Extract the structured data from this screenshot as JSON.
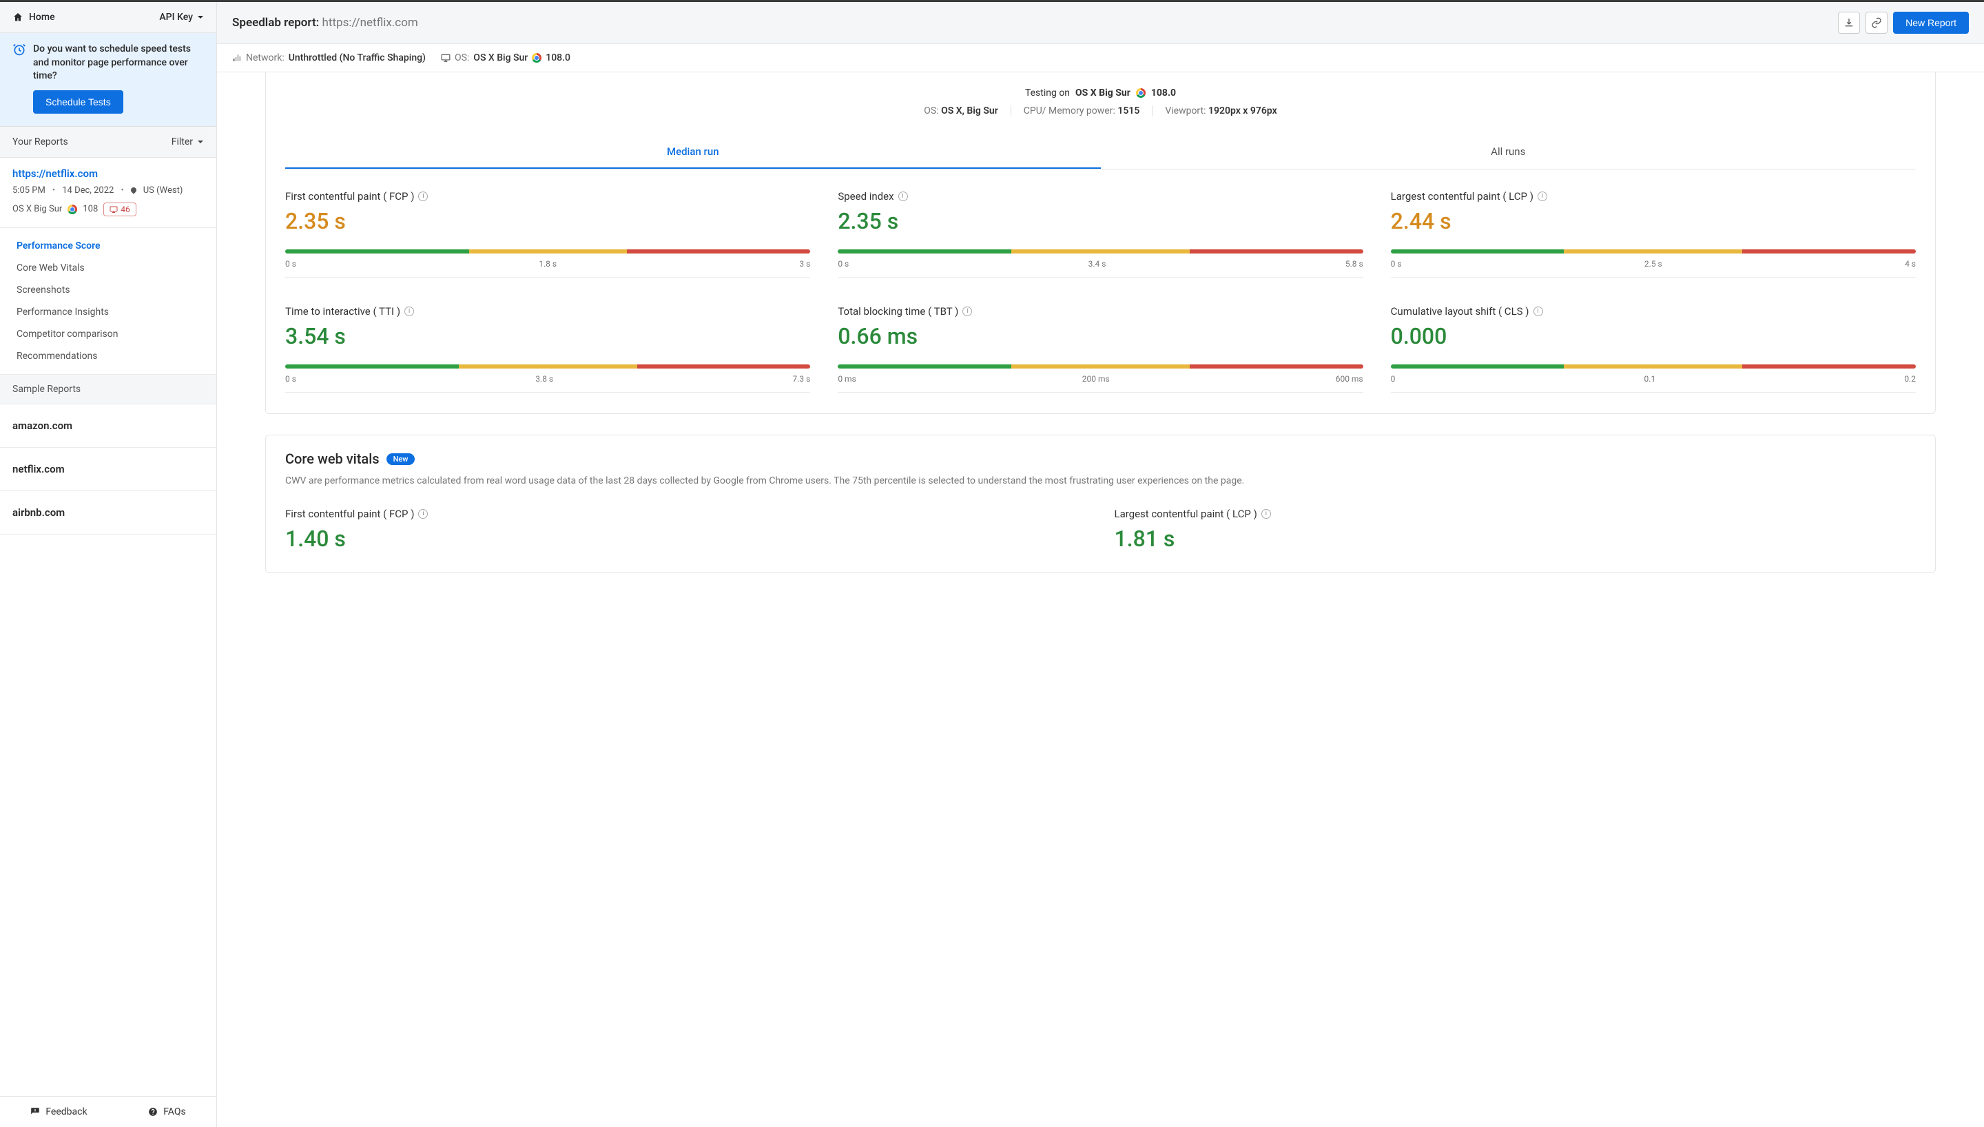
{
  "sidebar": {
    "home": "Home",
    "apikey": "API Key",
    "schedule_prompt": "Do you want to schedule speed tests and monitor page performance over time?",
    "schedule_btn": "Schedule Tests",
    "reports_title": "Your Reports",
    "filter_label": "Filter",
    "current_report": {
      "url": "https://netflix.com",
      "time": "5:05 PM",
      "date": "14 Dec, 2022",
      "location": "US (West)",
      "os": "OS X Big Sur",
      "browser_version": "108",
      "viewport_count": "46"
    },
    "nav": [
      "Performance Score",
      "Core Web Vitals",
      "Screenshots",
      "Performance Insights",
      "Competitor comparison",
      "Recommendations"
    ],
    "sample_header": "Sample Reports",
    "samples": [
      "amazon.com",
      "netflix.com",
      "airbnb.com"
    ],
    "feedback": "Feedback",
    "faqs": "FAQs"
  },
  "header": {
    "title_prefix": "Speedlab report: ",
    "title_url": "https://netflix.com",
    "new_report": "New Report"
  },
  "context_bar": {
    "network_label": "Network:",
    "network_value": "Unthrottled (No Traffic Shaping)",
    "os_label": "OS:",
    "os_value": "OS X Big Sur",
    "browser_version": "108.0"
  },
  "test_info": {
    "heading_prefix": "Testing on ",
    "heading_os": "OS X Big Sur",
    "heading_version": "108.0",
    "os_label": "OS:",
    "os_value": "OS X, Big Sur",
    "cpu_label": "CPU/ Memory power:",
    "cpu_value": "1515",
    "viewport_label": "Viewport:",
    "viewport_value": "1920px x 976px"
  },
  "tabs": {
    "median": "Median run",
    "all": "All runs"
  },
  "metrics": [
    {
      "title": "First contentful paint ( FCP )",
      "value": "2.35 s",
      "color": "orange",
      "ticks": [
        "0 s",
        "1.8 s",
        "3 s"
      ],
      "segs": [
        35,
        30,
        35
      ],
      "marker": 50,
      "marker_color": "orange"
    },
    {
      "title": "Speed index",
      "value": "2.35 s",
      "color": "green",
      "ticks": [
        "0 s",
        "3.4 s",
        "5.8 s"
      ],
      "segs": [
        33,
        34,
        33
      ],
      "marker": 25,
      "marker_color": "green"
    },
    {
      "title": "Largest contentful paint ( LCP )",
      "value": "2.44 s",
      "color": "orange",
      "ticks": [
        "0 s",
        "2.5 s",
        "4 s"
      ],
      "segs": [
        33,
        34,
        33
      ],
      "marker": 34,
      "marker_color": "green"
    },
    {
      "title": "Time to interactive ( TTI )",
      "value": "3.54 s",
      "color": "green",
      "ticks": [
        "0 s",
        "3.8 s",
        "7.3 s"
      ],
      "segs": [
        33,
        34,
        33
      ],
      "marker": 33,
      "marker_color": "green"
    },
    {
      "title": "Total blocking time ( TBT )",
      "value": "0.66 ms",
      "color": "green",
      "ticks": [
        "0 ms",
        "200 ms",
        "600 ms"
      ],
      "segs": [
        33,
        34,
        33
      ],
      "marker": 2,
      "marker_color": "green"
    },
    {
      "title": "Cumulative layout shift ( CLS )",
      "value": "0.000",
      "color": "green",
      "ticks": [
        "0",
        "0.1",
        "0.2"
      ],
      "segs": [
        33,
        34,
        33
      ],
      "marker": 2,
      "marker_color": "green"
    }
  ],
  "cwv": {
    "title": "Core web vitals",
    "badge": "New",
    "desc": "CWV are performance metrics calculated from real word usage data of the last 28 days collected by Google from Chrome users. The 75th percentile is selected to understand the most frustrating user experiences on the page.",
    "fcp_title": "First contentful paint ( FCP )",
    "fcp_value": "1.40 s",
    "lcp_title": "Largest contentful paint ( LCP )",
    "lcp_value": "1.81 s"
  }
}
